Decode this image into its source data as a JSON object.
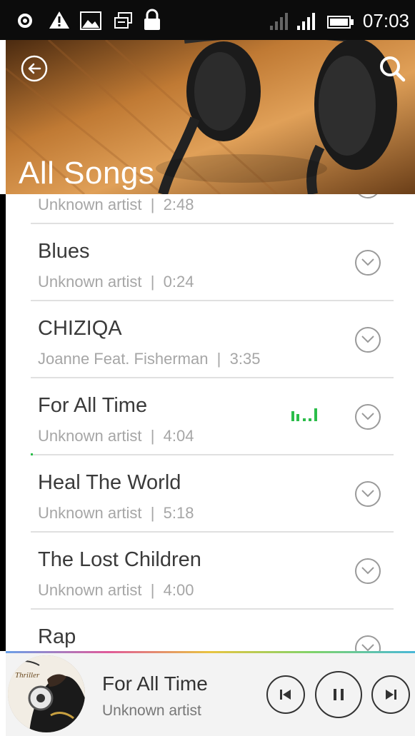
{
  "status_bar": {
    "time": "07:03",
    "icons": [
      "record-icon",
      "warning-icon",
      "image-icon",
      "screen-icon",
      "lock-icon",
      "signal-weak-icon",
      "signal-strong-icon",
      "battery-icon"
    ]
  },
  "header": {
    "title": "All Songs",
    "back_icon": "back-arrow-icon",
    "search_icon": "search-icon"
  },
  "songs": [
    {
      "title": "",
      "artist": "Unknown artist",
      "duration": "2:48",
      "meta": "Unknown artist  |  2:48"
    },
    {
      "title": "Blues",
      "artist": "Unknown artist",
      "duration": "0:24",
      "meta": "Unknown artist  |  0:24"
    },
    {
      "title": "CHIZIQA",
      "artist": "Joanne Feat. Fisherman",
      "duration": "3:35",
      "meta": "Joanne Feat. Fisherman  |  3:35"
    },
    {
      "title": "For All Time",
      "artist": "Unknown artist",
      "duration": "4:04",
      "meta": "Unknown artist  |  4:04",
      "playing": true
    },
    {
      "title": "Heal The World",
      "artist": "Unknown artist",
      "duration": "5:18",
      "meta": "Unknown artist  |  5:18"
    },
    {
      "title": "The Lost Children",
      "artist": "Unknown artist",
      "duration": "4:00",
      "meta": "Unknown artist  |  4:00"
    },
    {
      "title": "Rap",
      "artist": "",
      "duration": "",
      "meta": ""
    }
  ],
  "player": {
    "title": "For All Time",
    "artist": "Unknown artist",
    "album_art_text": "Thriller",
    "controls": [
      "previous-icon",
      "pause-icon",
      "next-icon"
    ]
  },
  "colors": {
    "accent_green": "#2bbd4a",
    "text_primary": "#3a3a3a",
    "text_secondary": "#a6a6a6"
  }
}
